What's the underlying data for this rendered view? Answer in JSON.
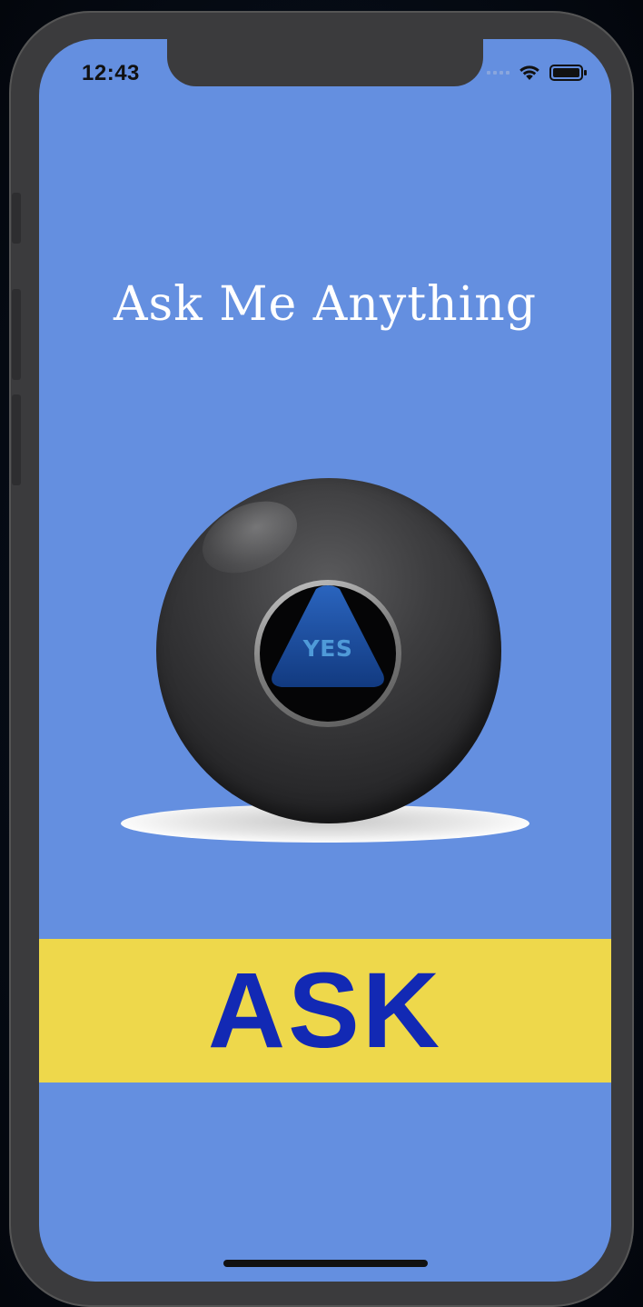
{
  "status_bar": {
    "time": "12:43",
    "icons": [
      "cellular-signal-icon",
      "wifi-icon",
      "battery-icon"
    ]
  },
  "app": {
    "title": "Ask Me Anything",
    "answer": "YES",
    "ask_button_label": "ASK"
  },
  "colors": {
    "background": "#648fe0",
    "button_background": "#eed84b",
    "button_text": "#1229b4",
    "title_text": "#ffffff",
    "answer_text": "#4f9ad8",
    "ball": "#2b2b2d",
    "triangle": "#1c4fa0"
  }
}
